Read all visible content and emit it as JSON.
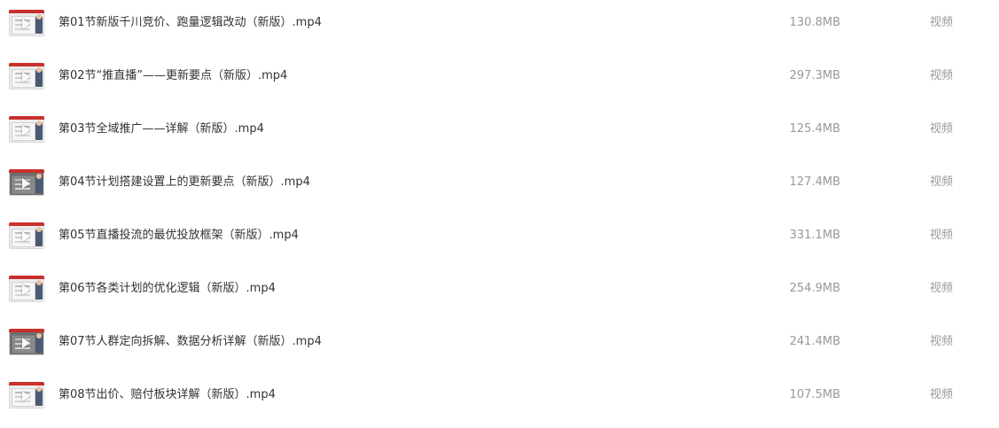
{
  "files": [
    {
      "name": "第01节新版千川竞价、跑量逻辑改动（新版）.mp4",
      "size": "130.8MB",
      "type": "视频",
      "thumb_tone": "light"
    },
    {
      "name": "第02节“推直播”——更新要点（新版）.mp4",
      "size": "297.3MB",
      "type": "视频",
      "thumb_tone": "light"
    },
    {
      "name": "第03节全域推广——详解（新版）.mp4",
      "size": "125.4MB",
      "type": "视频",
      "thumb_tone": "light"
    },
    {
      "name": "第04节计划搭建设置上的更新要点（新版）.mp4",
      "size": "127.4MB",
      "type": "视频",
      "thumb_tone": "dark"
    },
    {
      "name": "第05节直播投流的最优投放框架（新版）.mp4",
      "size": "331.1MB",
      "type": "视频",
      "thumb_tone": "light"
    },
    {
      "name": "第06节各类计划的优化逻辑（新版）.mp4",
      "size": "254.9MB",
      "type": "视频",
      "thumb_tone": "light"
    },
    {
      "name": "第07节人群定向拆解、数据分析详解（新版）.mp4",
      "size": "241.4MB",
      "type": "视频",
      "thumb_tone": "dark"
    },
    {
      "name": "第08节出价、赔付板块详解（新版）.mp4",
      "size": "107.5MB",
      "type": "视频",
      "thumb_tone": "light"
    }
  ],
  "icons": {
    "thumbnail": "video-thumbnail-icon"
  }
}
